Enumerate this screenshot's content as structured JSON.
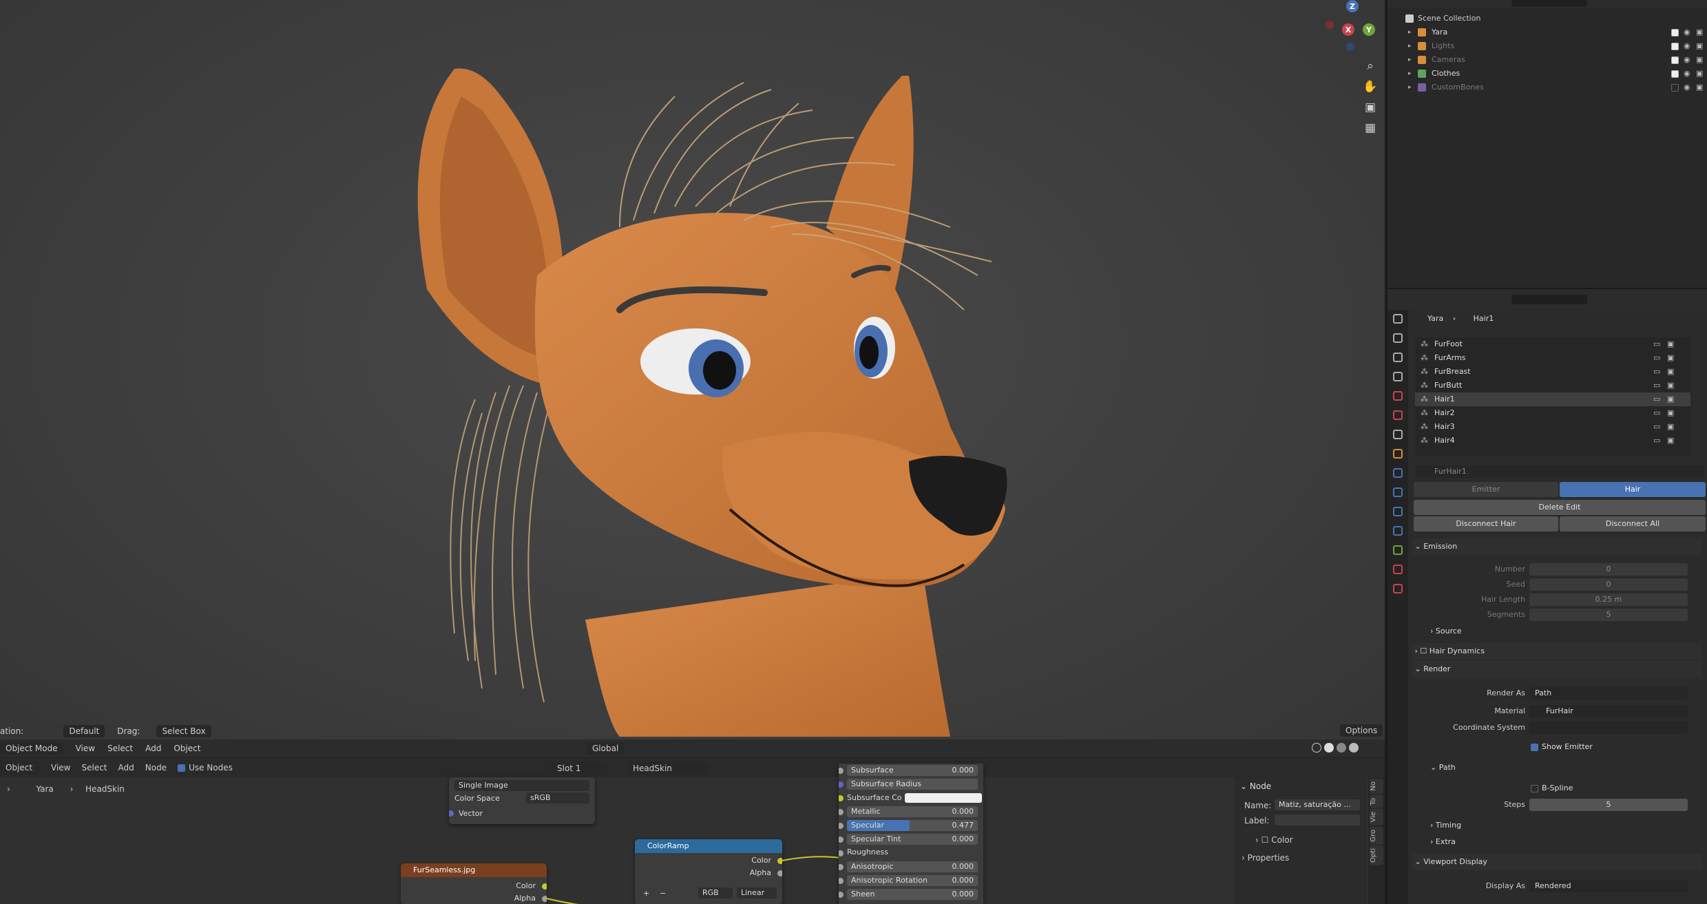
{
  "colors": {
    "viewport_bg": "#3d3d3d",
    "character_orange": "#c8783c",
    "hair_beige": "#c9a67a",
    "nose_dark": "#1c1c1c",
    "accent_blue": "#4772b3",
    "selected_blue": "#4a6fb0",
    "node_image_header": "#7a3f1f",
    "node_converter_header": "#2a6a9c"
  },
  "viewport": {
    "header_tool": {
      "orientation_label": "ation:",
      "orientation_value": "Default",
      "drag_label": "Drag:",
      "drag_value": "Select Box",
      "options": "Options"
    },
    "header_menu": {
      "mode": "Object Mode",
      "view": "View",
      "select": "Select",
      "add": "Add",
      "object": "Object",
      "transform": "Global"
    },
    "gizmo": {
      "z": "Z",
      "y": "Y",
      "x": "X"
    },
    "nav_icons": [
      "zoom-icon",
      "hand-icon",
      "camera-icon",
      "grid-icon"
    ]
  },
  "node_editor": {
    "header": {
      "editor_type": "Object",
      "view": "View",
      "select": "Select",
      "add": "Add",
      "node": "Node",
      "use_nodes": "Use Nodes",
      "slot": "Slot 1",
      "material": "HeadSkin"
    },
    "breadcrumb": {
      "object": "Yara",
      "material": "HeadSkin"
    },
    "image_node": {
      "mode": "Single Image",
      "color_space_label": "Color Space",
      "color_space_value": "sRGB",
      "vector": "Vector"
    },
    "fur_node": {
      "title": "FurSeamless.jpg",
      "color": "Color",
      "alpha": "Alpha"
    },
    "colorramp_node": {
      "title": "ColorRamp",
      "color": "Color",
      "alpha": "Alpha",
      "add": "+",
      "remove": "−",
      "mode": "RGB",
      "interp": "Linear"
    },
    "bsdf_fields": [
      {
        "label": "Subsurface",
        "value": "0.000"
      },
      {
        "label": "Subsurface Radius",
        "value": ""
      },
      {
        "label": "Subsurface Co",
        "value": ""
      },
      {
        "label": "Metallic",
        "value": "0.000"
      },
      {
        "label": "Specular",
        "value": "0.477"
      },
      {
        "label": "Specular Tint",
        "value": "0.000"
      },
      {
        "label": "Roughness",
        "value": ""
      },
      {
        "label": "Anisotropic",
        "value": "0.000"
      },
      {
        "label": "Anisotropic Rotation",
        "value": "0.000"
      },
      {
        "label": "Sheen",
        "value": "0.000"
      }
    ],
    "specular_fill": 0.477,
    "side_panel": {
      "section": "Node",
      "name_label": "Name:",
      "name_value": "Matiz, saturação ...",
      "label_label": "Label:",
      "color": "Color",
      "properties": "Properties"
    },
    "side_tabs": [
      "No",
      "To",
      "Vie",
      "Gro",
      "Opti"
    ]
  },
  "outliner": {
    "root": "Scene Collection",
    "items": [
      {
        "name": "Yara",
        "dim": false,
        "color": "#d98c3a",
        "checked": true
      },
      {
        "name": "Lights",
        "dim": true,
        "color": "#d98c3a",
        "checked": true
      },
      {
        "name": "Cameras",
        "dim": true,
        "color": "#d98c3a",
        "checked": true
      },
      {
        "name": "Clothes",
        "dim": false,
        "color": "#5fa35f",
        "checked": true
      },
      {
        "name": "CustomBones",
        "dim": true,
        "color": "#7a5fa3",
        "checked": false
      }
    ]
  },
  "properties": {
    "breadcrumb": {
      "object": "Yara",
      "system": "Hair1"
    },
    "particle_list": [
      "FurFoot",
      "FurArms",
      "FurBreast",
      "FurButt",
      "Hair1",
      "Hair2",
      "Hair3",
      "Hair4"
    ],
    "selected_particle": "Hair1",
    "settings_name": "FurHair1",
    "type_tabs": {
      "emitter": "Emitter",
      "hair": "Hair"
    },
    "buttons": {
      "delete_edit": "Delete Edit",
      "disconnect_hair": "Disconnect Hair",
      "disconnect_all": "Disconnect All"
    },
    "emission": {
      "header": "Emission",
      "fields": [
        {
          "label": "Number",
          "value": "0"
        },
        {
          "label": "Seed",
          "value": "0"
        },
        {
          "label": "Hair Length",
          "value": "0.25 m"
        },
        {
          "label": "Segments",
          "value": "5"
        }
      ]
    },
    "source": "Source",
    "hair_dynamics": "Hair Dynamics",
    "render": {
      "header": "Render",
      "render_as_label": "Render As",
      "render_as_value": "Path",
      "material_label": "Material",
      "material_value": "FurHair",
      "coord_label": "Coordinate System",
      "show_emitter": "Show Emitter",
      "path_header": "Path",
      "bspline": "B-Spline",
      "steps_label": "Steps",
      "steps_value": "5",
      "timing": "Timing",
      "extra": "Extra"
    },
    "viewport_display": {
      "header": "Viewport Display",
      "display_as_label": "Display As",
      "display_as_value": "Rendered"
    }
  }
}
